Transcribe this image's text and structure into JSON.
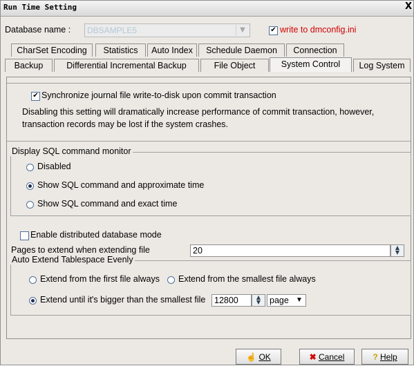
{
  "window": {
    "title": "Run Time Setting",
    "close_label": "X"
  },
  "db": {
    "label": "Database name :",
    "value": "DBSAMPLE5",
    "write_label": "write to dmconfig.ini",
    "write_checked": true
  },
  "tabs_row1": [
    "CharSet Encoding",
    "Statistics",
    "Auto Index",
    "Schedule Daemon",
    "Connection"
  ],
  "tabs_row2": [
    "Backup",
    "Differential Incremental Backup",
    "File Object",
    "System Control",
    "Log System"
  ],
  "active_tab": "System Control",
  "sync": {
    "label": "Synchronize journal file write-to-disk upon commit transaction",
    "checked": true,
    "desc_line1": "Disabling this setting will dramatically increase performance of commit transaction, however,",
    "desc_line2": "transaction records may be lost if the system crashes."
  },
  "sql_monitor": {
    "legend": "Display SQL command monitor",
    "options": [
      "Disabled",
      "Show SQL command and approximate time",
      "Show SQL command and exact time"
    ],
    "selected": 1
  },
  "distributed": {
    "label": "Enable distributed database mode",
    "checked": false
  },
  "extend": {
    "label": "Pages to extend when extending file",
    "value": "20"
  },
  "auto_extend": {
    "legend": "Auto Extend Tablespace Evenly",
    "opt_first": "Extend from the first file always",
    "opt_smallest": "Extend from the smallest file always",
    "opt_bigger": "Extend until it's bigger than the smallest file",
    "value": "12800",
    "unit": "page"
  },
  "buttons": {
    "ok": "OK",
    "cancel": "Cancel",
    "help": "Help"
  }
}
